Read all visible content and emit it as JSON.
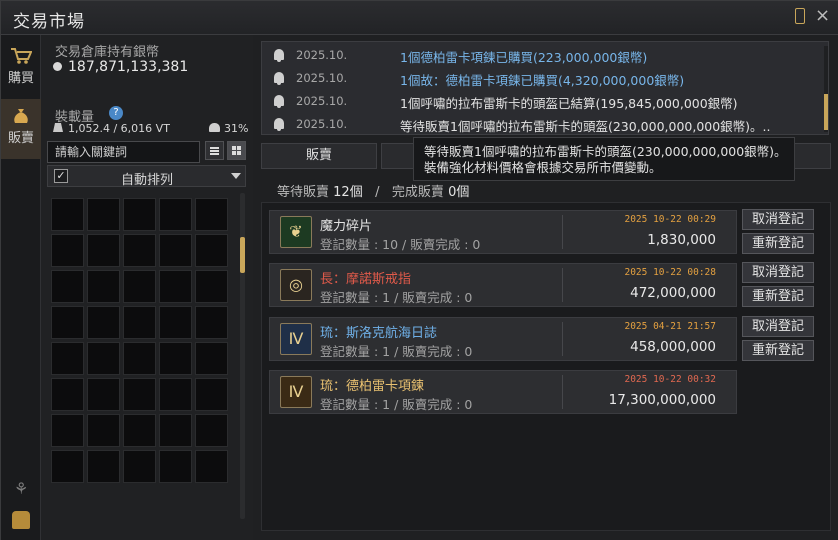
{
  "window": {
    "title": "交易市場"
  },
  "rail": {
    "tabs": [
      {
        "label": "購買",
        "icon": "cart-icon"
      },
      {
        "label": "販賣",
        "icon": "money-bag-icon"
      }
    ],
    "bottom_icons": [
      "tree-icon",
      "backpack-icon"
    ]
  },
  "left": {
    "silver_label": "交易倉庫持有銀幣",
    "silver_value": "187,871,133,381",
    "weight_label": "裝載量",
    "help_icon": "?",
    "weight_value": "1,052.4 / 6,016 VT",
    "weight_percent": "31%",
    "search_placeholder": "請輸入關鍵詞",
    "sort_checked": "✓",
    "sort_label": "自動排列",
    "slot_count": 40
  },
  "log": [
    {
      "date": "2025.10.",
      "text": "1個德柏雷卡項鍊已購買(223,000,000銀幣)",
      "color": "blue"
    },
    {
      "date": "2025.10.",
      "text": "1個故：德柏雷卡項鍊已購買(4,320,000,000銀幣)",
      "color": "blue"
    },
    {
      "date": "2025.10.",
      "text": "1個呼嘯的拉布雷斯卡的頭盔已結算(195,845,000,000銀幣)",
      "color": "white"
    },
    {
      "date": "2025.10.",
      "text": "等待販賣1個呼嘯的拉布雷斯卡的頭盔(230,000,000,000銀幣)。..",
      "color": "white"
    }
  ],
  "tabs": {
    "sell": "販賣"
  },
  "tooltip": {
    "line1": "等待販賣1個呼嘯的拉布雷斯卡的頭盔(230,000,000,000銀幣)。",
    "line2": "裝備強化材料價格會根據交易所市價變動。"
  },
  "summary": {
    "waiting_label": "等待販賣",
    "waiting_count": "12個",
    "separator": "/",
    "done_label": "完成販賣",
    "done_count": "0個"
  },
  "items": [
    {
      "name": "魔力碎片",
      "name_color": "#e4e4e4",
      "sub": "登記數量 : 10 / 販賣完成 : 0",
      "time": "2025 10-22 00:29",
      "time_color": "orange",
      "price": "1,830,000",
      "icon": "magic-shard-icon",
      "icon_bg": "#1d3a22",
      "buttons": [
        "取消登記",
        "重新登記"
      ]
    },
    {
      "name": "長：摩諾斯戒指",
      "name_color": "#e05a4a",
      "sub": "登記數量 : 1 / 販賣完成 : 0",
      "time": "2025 10-22 00:28",
      "time_color": "orange",
      "price": "472,000,000",
      "icon": "ring-icon",
      "icon_bg": "#2a2520",
      "buttons": [
        "取消登記",
        "重新登記"
      ]
    },
    {
      "name": "琉：斯洛克航海日誌",
      "name_color": "#6fb0e8",
      "sub": "登記數量 : 1 / 販賣完成 : 0",
      "time": "2025 04-21 21:57",
      "time_color": "orange",
      "price": "458,000,000",
      "icon": "logbook-icon",
      "icon_bg": "#1f2f48",
      "buttons": [
        "取消登記",
        "重新登記"
      ]
    },
    {
      "name": "琉：德柏雷卡項鍊",
      "name_color": "#e8c070",
      "sub": "登記數量 : 1 / 販賣完成 : 0",
      "time": "2025 10-22 00:32",
      "time_color": "red",
      "price": "17,300,000,000",
      "icon": "necklace-icon",
      "icon_bg": "#3a2a15",
      "buttons": []
    }
  ]
}
